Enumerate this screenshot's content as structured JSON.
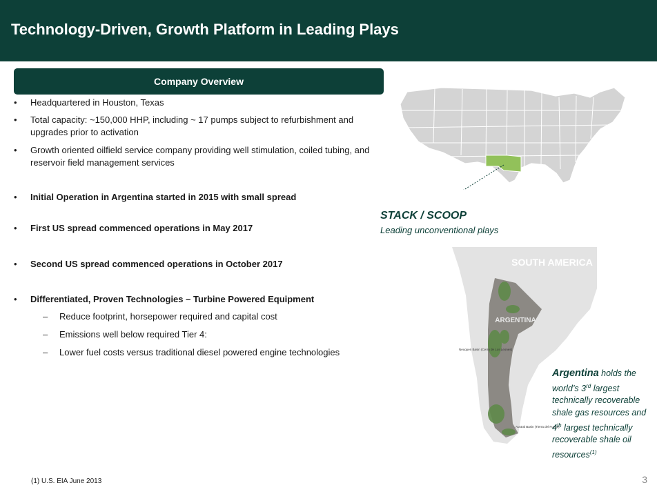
{
  "header": {
    "title": "Technology-Driven, Growth Platform in Leading Plays"
  },
  "overview": {
    "title": "Company Overview",
    "bullets": [
      {
        "text": "Headquartered in Houston, Texas"
      },
      {
        "text": "Total capacity: ~150,000 HHP, including ~ 17 pumps subject to refurbishment and upgrades prior to activation"
      },
      {
        "text": "Growth oriented oilfield service company providing well stimulation, coiled tubing, and reservoir field management services"
      },
      {
        "text": "Initial Operation in Argentina started in 2015 with small spread"
      },
      {
        "text": "First US spread commenced operations in May 2017"
      },
      {
        "text": "Second US spread commenced operations in October 2017"
      },
      {
        "text": "Differentiated, Proven Technologies – Turbine Powered Equipment"
      }
    ],
    "sub_bullets": [
      {
        "text": "Reduce footprint, horsepower required and capital cost"
      },
      {
        "text": "Emissions well below required Tier 4:"
      },
      {
        "text": "Lower fuel costs versus traditional diesel powered engine technologies"
      }
    ],
    "bullet_marker": "•",
    "sub_marker": "–"
  },
  "us_map": {
    "label_title": "STACK / SCOOP",
    "label_subtitle": "Leading unconventional plays",
    "highlight_color": "#92c15a",
    "state_color": "#d4d4d4"
  },
  "sa_map": {
    "continent_label": "SOUTH AMERICA",
    "country_label": "ARGENTINA",
    "basin1_label": "Neuquen Basin (Cerro de Los Leones)",
    "basin2_label": "Austral Basin (Tierra del Fuego)",
    "shale_color": "#5f8a4a",
    "country_color": "#8c8984"
  },
  "argentina_note": {
    "country": "Argentina",
    "p1": "holds the world’s 3",
    "sup1": "rd",
    "p2": "largest technically recoverable shale gas resources and 4",
    "sup2": "th",
    "p3": "largest technically recoverable shale oil resources",
    "sup3": "(1)"
  },
  "footer": {
    "footnote": "(1)   U.S. EIA June 2013",
    "page_number": "3"
  }
}
